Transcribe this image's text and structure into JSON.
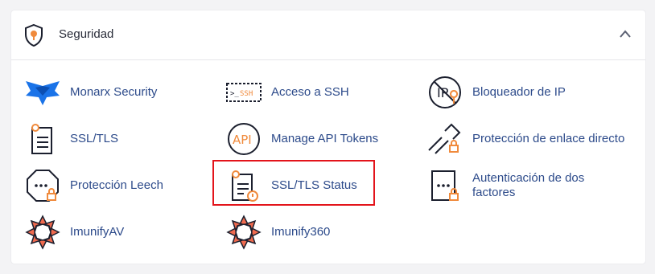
{
  "section": {
    "title": "Seguridad",
    "header_icon": "shield-lock-icon",
    "collapse_icon": "chevron-up-icon"
  },
  "tools": [
    {
      "label": "Monarx Security",
      "icon": "monarx-butterfly-icon"
    },
    {
      "label": "Acceso a SSH",
      "icon": "ssh-terminal-icon",
      "icon_text": ">_SSH"
    },
    {
      "label": "Bloqueador de IP",
      "icon": "ip-blocker-icon",
      "icon_text": "IP"
    },
    {
      "label": "SSL/TLS",
      "icon": "ssl-certificate-icon"
    },
    {
      "label": "Manage API Tokens",
      "icon": "api-tokens-icon",
      "icon_text": "API"
    },
    {
      "label": "Protección de enlace directo",
      "icon": "hotlink-protection-icon"
    },
    {
      "label": "Protección Leech",
      "icon": "leech-protection-icon"
    },
    {
      "label": "SSL/TLS Status",
      "icon": "ssl-status-icon"
    },
    {
      "label": "Autenticación de dos factores",
      "icon": "two-factor-auth-icon"
    },
    {
      "label": "ImunifyAV",
      "icon": "imunifyav-icon"
    },
    {
      "label": "Imunify360",
      "icon": "imunify360-icon"
    }
  ],
  "colors": {
    "link": "#2c4a8a",
    "icon_dark": "#1b1f2e",
    "accent_orange": "#f08a3c",
    "monarx_blue": "#1a73e8",
    "highlight": "#e3141b"
  }
}
